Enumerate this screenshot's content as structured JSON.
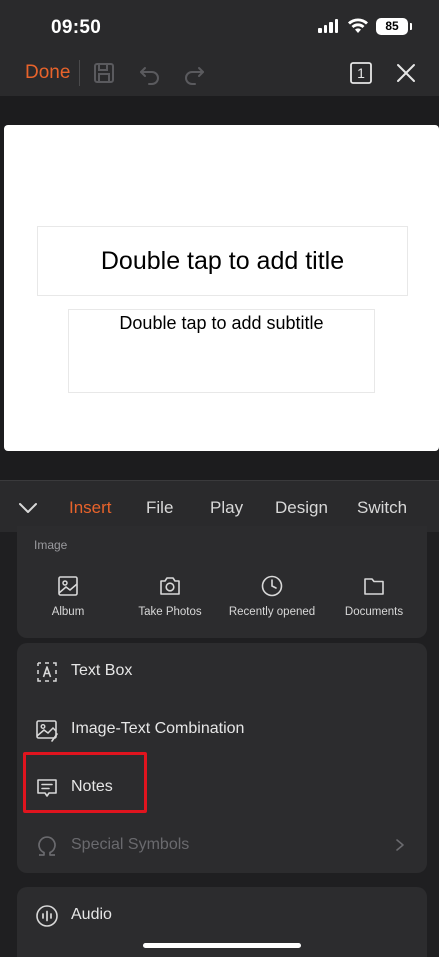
{
  "status_bar": {
    "time": "09:50",
    "battery": "85"
  },
  "toolbar": {
    "done_label": "Done",
    "slide_counter": "1",
    "accent_color": "#e8632b"
  },
  "slide": {
    "title_placeholder": "Double tap to add title",
    "subtitle_placeholder": "Double tap to add subtitle"
  },
  "tabs": [
    {
      "label": "Insert",
      "active": true
    },
    {
      "label": "File"
    },
    {
      "label": "Play"
    },
    {
      "label": "Design"
    },
    {
      "label": "Switch"
    }
  ],
  "image_section": {
    "label": "Image",
    "items": [
      {
        "label": "Album",
        "icon": "album-icon"
      },
      {
        "label": "Take Photos",
        "icon": "camera-icon"
      },
      {
        "label": "Recently opened",
        "icon": "clock-icon"
      },
      {
        "label": "Documents",
        "icon": "folder-icon"
      }
    ]
  },
  "insert_list": [
    {
      "label": "Text Box",
      "icon": "text-box-icon"
    },
    {
      "label": "Image-Text Combination",
      "icon": "image-text-icon"
    },
    {
      "label": "Notes",
      "icon": "notes-icon"
    },
    {
      "label": "Special Symbols",
      "icon": "omega-icon",
      "disabled": true
    }
  ],
  "audio": {
    "label": "Audio",
    "icon": "audio-icon"
  }
}
